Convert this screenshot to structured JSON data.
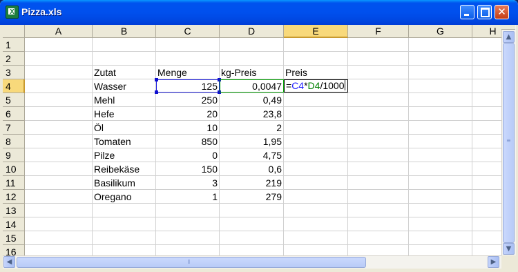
{
  "window": {
    "title": "Pizza.xls"
  },
  "columns": [
    "A",
    "B",
    "C",
    "D",
    "E",
    "F",
    "G",
    "H"
  ],
  "rows": [
    "1",
    "2",
    "3",
    "4",
    "5",
    "6",
    "7",
    "8",
    "9",
    "10",
    "11",
    "12",
    "13",
    "14",
    "15",
    "16"
  ],
  "header_row": {
    "zutat": "Zutat",
    "menge": "Menge",
    "kg_preis": "kg-Preis",
    "preis": "Preis"
  },
  "data_rows": [
    {
      "name": "Wasser",
      "menge": "125",
      "kg_preis": "0,0047"
    },
    {
      "name": "Mehl",
      "menge": "250",
      "kg_preis": "0,49"
    },
    {
      "name": "Hefe",
      "menge": "20",
      "kg_preis": "23,8"
    },
    {
      "name": "Öl",
      "menge": "10",
      "kg_preis": "2"
    },
    {
      "name": "Tomaten",
      "menge": "850",
      "kg_preis": "1,95"
    },
    {
      "name": "Pilze",
      "menge": "0",
      "kg_preis": "4,75"
    },
    {
      "name": "Reibekäse",
      "menge": "150",
      "kg_preis": "0,6"
    },
    {
      "name": "Basilikum",
      "menge": "3",
      "kg_preis": "219"
    },
    {
      "name": "Oregano",
      "menge": "1",
      "kg_preis": "279"
    }
  ],
  "active_cell": {
    "address": "E4",
    "formula_parts": {
      "eq": "=",
      "ref1": "C4",
      "op": "*",
      "ref2": "D4",
      "rest": "/1000"
    }
  },
  "colors": {
    "ref1": "#1a1aff",
    "ref2": "#008000",
    "selected_header": "#f8d97b"
  }
}
